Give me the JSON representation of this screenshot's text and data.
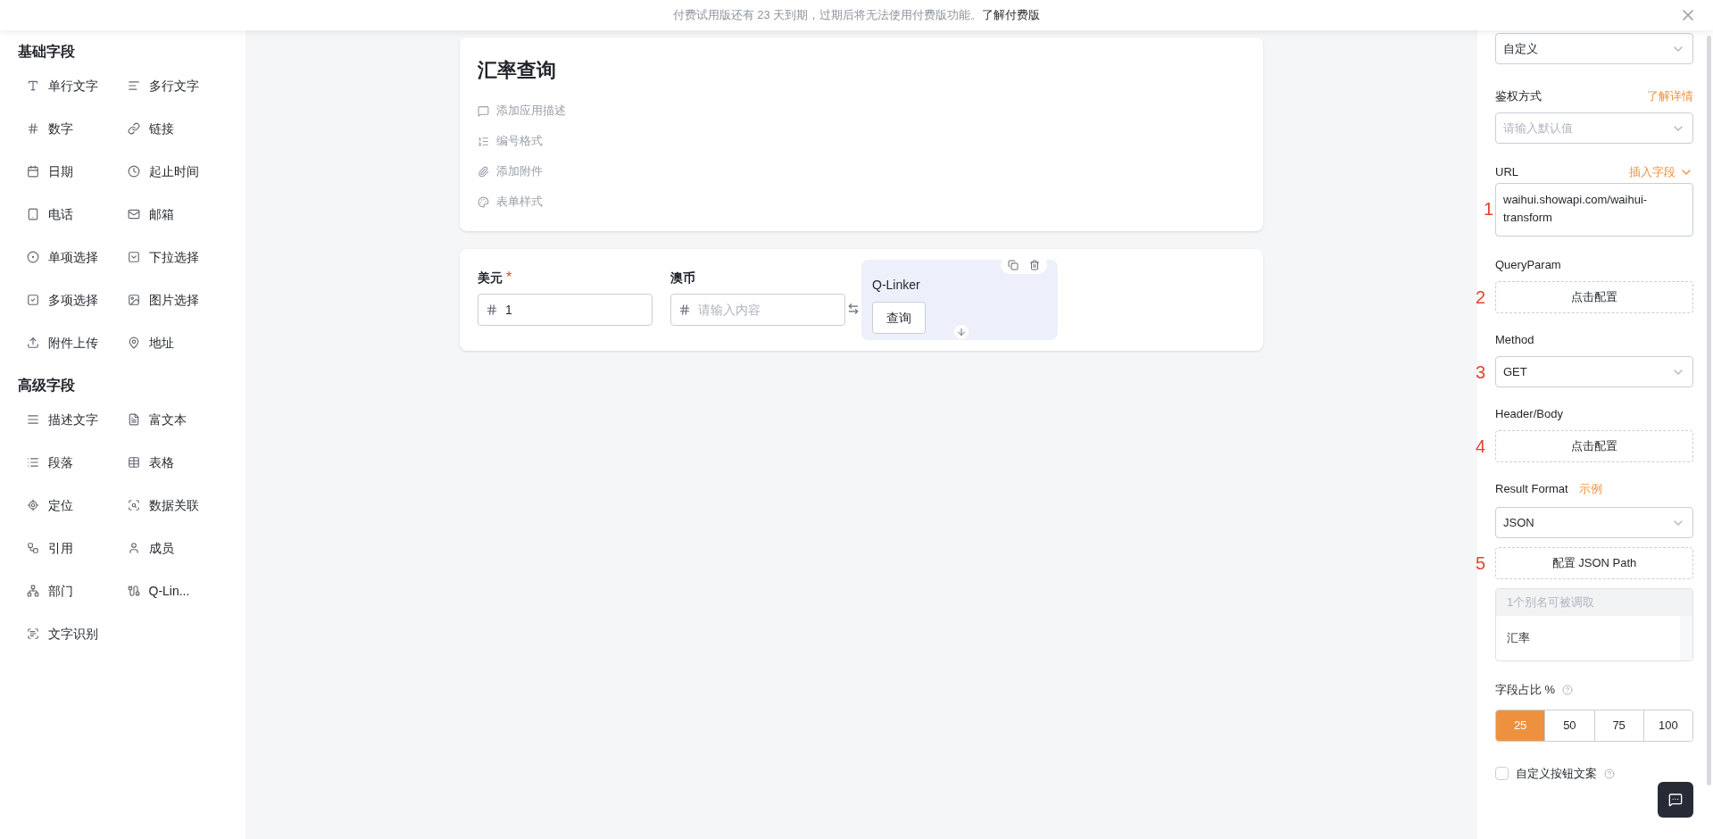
{
  "banner": {
    "text": "付费试用版还有 23 天到期，过期后将无法使用付费版功能。",
    "link": "了解付费版"
  },
  "sidebar": {
    "groups": [
      {
        "title": "基础字段",
        "items": [
          "单行文字",
          "多行文字",
          "数字",
          "链接",
          "日期",
          "起止时间",
          "电话",
          "邮箱",
          "单项选择",
          "下拉选择",
          "多项选择",
          "图片选择",
          "附件上传",
          "地址"
        ]
      },
      {
        "title": "高级字段",
        "items": [
          "描述文字",
          "富文本",
          "段落",
          "表格",
          "定位",
          "数据关联",
          "引用",
          "成员",
          "部门",
          "Q-Lin...",
          "文字识别"
        ]
      }
    ]
  },
  "form": {
    "title": "汇率查询",
    "actions": [
      "添加应用描述",
      "编号格式",
      "添加附件",
      "表单样式"
    ],
    "fields": [
      {
        "label": "美元",
        "required_mark": "*",
        "value": "1"
      },
      {
        "label": "澳币",
        "placeholder": "请输入内容"
      }
    ],
    "linker": {
      "title": "Q-Linker",
      "button": "查询"
    }
  },
  "panel": {
    "top_select": "自定义",
    "auth": {
      "label": "鉴权方式",
      "link": "了解详情",
      "placeholder": "请输入默认值"
    },
    "url": {
      "label": "URL",
      "link": "插入字段",
      "lines": [
        "waihui.showapi.com/waihui-",
        "transform"
      ]
    },
    "query": {
      "label": "QueryParam",
      "button": "点击配置"
    },
    "method": {
      "label": "Method",
      "value": "GET"
    },
    "header": {
      "label": "Header/Body",
      "button": "点击配置"
    },
    "result": {
      "label": "Result Format",
      "link": "示例",
      "value": "JSON",
      "button": "配置 JSON Path"
    },
    "aliases": {
      "header": "1个别名可被调取",
      "rows": [
        "汇率"
      ]
    },
    "width": {
      "label": "字段占比 %",
      "options": [
        {
          "label": "25",
          "selected": true
        },
        {
          "label": "50",
          "selected": false
        },
        {
          "label": "75",
          "selected": false
        },
        {
          "label": "100",
          "selected": false
        }
      ]
    },
    "custom_button": {
      "label": "自定义按钮文案",
      "checked": false
    }
  },
  "annotations": [
    "1",
    "2",
    "3",
    "4",
    "5"
  ]
}
